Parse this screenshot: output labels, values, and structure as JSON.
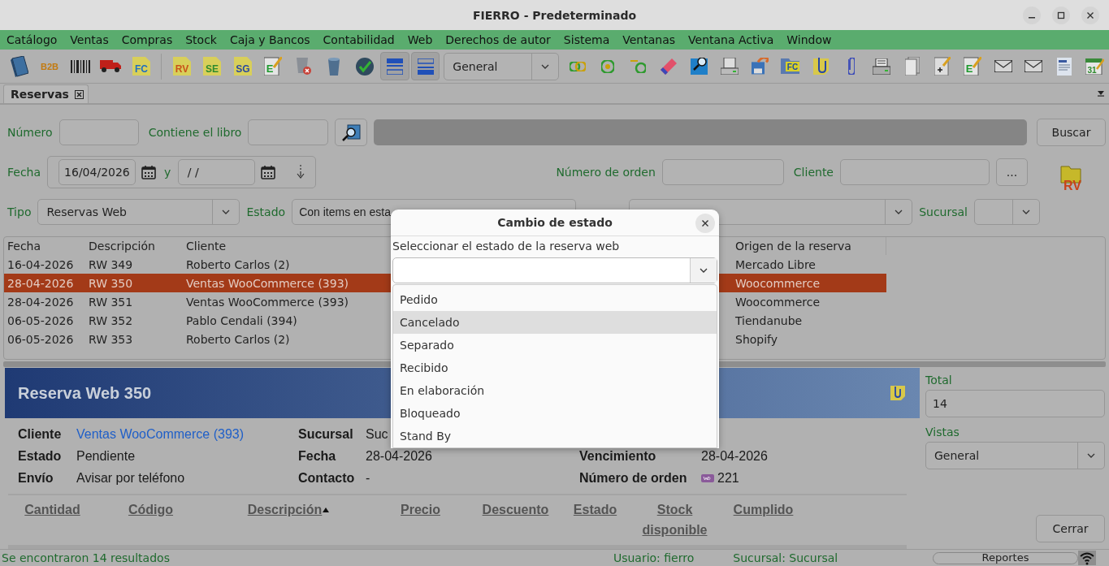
{
  "window": {
    "title": "FIERRO - Predeterminado"
  },
  "menu": [
    "Catálogo",
    "Ventas",
    "Compras",
    "Stock",
    "Caja y Bancos",
    "Contabilidad",
    "Web",
    "Derechos de autor",
    "Sistema",
    "Ventanas",
    "Ventana Activa",
    "Window"
  ],
  "toolbar": [
    {
      "kind": "book",
      "pressed": false
    },
    {
      "kind": "lettermark",
      "label": "B2B",
      "pressed": false
    },
    {
      "kind": "barcode",
      "pressed": false
    },
    {
      "kind": "truck",
      "pressed": false
    },
    {
      "kind": "doc",
      "label": "FC",
      "color": "#1f6fc0",
      "pressed": false
    },
    {
      "kind": "separator"
    },
    {
      "kind": "doc",
      "label": "RV",
      "color": "#c8521a",
      "pressed": false
    },
    {
      "kind": "doc",
      "label": "SE",
      "color": "#2e8b2e",
      "pressed": false
    },
    {
      "kind": "doc",
      "label": "SG",
      "color": "#2a4aa0",
      "pressed": false
    },
    {
      "kind": "edit",
      "label": "E",
      "color": "#1e9a2e",
      "pressed": false
    },
    {
      "kind": "bin-x",
      "pressed": false
    },
    {
      "kind": "bin",
      "pressed": false
    },
    {
      "kind": "refresh",
      "pressed": false
    },
    {
      "kind": "layout-top",
      "pressed": true
    },
    {
      "kind": "layout-bottom",
      "pressed": true
    },
    {
      "kind": "combo",
      "value": "General"
    },
    {
      "kind": "rings",
      "pressed": false
    },
    {
      "kind": "ring",
      "pressed": false
    },
    {
      "kind": "ring-line",
      "pressed": false
    },
    {
      "kind": "eraser",
      "pressed": false
    },
    {
      "kind": "search-doc",
      "pressed": false
    },
    {
      "kind": "printer-doc",
      "pressed": false
    },
    {
      "kind": "save",
      "pressed": false
    },
    {
      "kind": "folder-doc",
      "label": "FC",
      "color": "#1f4fa0",
      "pressed": false
    },
    {
      "kind": "note-clip",
      "pressed": false
    },
    {
      "kind": "clip",
      "pressed": false
    },
    {
      "kind": "printer",
      "pressed": false
    },
    {
      "kind": "pages",
      "pressed": false
    },
    {
      "kind": "doc-plus",
      "pressed": false
    },
    {
      "kind": "edit",
      "label": "E",
      "color": "#1e9a2e",
      "pressed": false
    },
    {
      "kind": "mail",
      "pressed": false
    },
    {
      "kind": "mail",
      "pressed": false
    },
    {
      "kind": "form",
      "pressed": false
    },
    {
      "kind": "calendar",
      "label": "31",
      "color": "#2e8b2e",
      "pressed": false
    }
  ],
  "tabs": [
    {
      "label": "Reservas",
      "selected": true
    }
  ],
  "filters": {
    "numero": {
      "label": "Número"
    },
    "libro": {
      "label": "Contiene el libro"
    },
    "search_button": "Buscar",
    "fecha": {
      "label": "Fecha",
      "from": "16/04/2026",
      "joiner": "y",
      "to": " / /"
    },
    "orden": {
      "label": "Número de orden"
    },
    "cliente": {
      "label": "Cliente",
      "button": "..."
    },
    "rv_icon": {
      "label": "RV"
    },
    "tipo": {
      "label": "Tipo",
      "value": "Reservas Web"
    },
    "estado": {
      "label": "Estado",
      "value": "Con items en esta"
    },
    "sucursal": {
      "label": "Sucursal"
    }
  },
  "table": {
    "columns": [
      "Fecha",
      "Descripción",
      "Cliente",
      "",
      "Origen de la reserva"
    ],
    "rows": [
      {
        "cells": [
          "16-04-2026",
          "RW 349",
          "Roberto Carlos (2)",
          "",
          "Mercado Libre"
        ],
        "selected": false
      },
      {
        "cells": [
          "28-04-2026",
          "RW 350",
          "Ventas WooCommerce (393)",
          "",
          "Woocommerce"
        ],
        "selected": true
      },
      {
        "cells": [
          "28-04-2026",
          "RW 351",
          "Ventas WooCommerce (393)",
          "",
          "Woocommerce"
        ],
        "selected": false
      },
      {
        "cells": [
          "06-05-2026",
          "RW 352",
          "Pablo Cendali (394)",
          "",
          "Tiendanube"
        ],
        "selected": false
      },
      {
        "cells": [
          "06-05-2026",
          "RW 353",
          "Roberto Carlos (2)",
          "",
          "Shopify"
        ],
        "selected": false
      }
    ]
  },
  "detail": {
    "title": "Reserva Web 350",
    "fields": [
      {
        "label": "Cliente",
        "value": "Ventas WooCommerce (393)",
        "kind": "link"
      },
      {
        "label": "Sucursal",
        "value": "Suc",
        "kind": "text"
      },
      {
        "kind": "empty"
      },
      {
        "label": "Estado",
        "value": "Pendiente",
        "kind": "text"
      },
      {
        "label": "Fecha",
        "value": "28-04-2026",
        "kind": "text"
      },
      {
        "label": "Vencimiento",
        "value": "28-04-2026",
        "kind": "text"
      },
      {
        "label": "Envío",
        "value": "Avisar por teléfono",
        "kind": "text"
      },
      {
        "label": "Contacto",
        "value": "-",
        "kind": "text"
      },
      {
        "label": "Número de orden",
        "value": "221",
        "kind": "woo"
      }
    ],
    "columns": [
      {
        "label": "Cantidad",
        "sorted": false
      },
      {
        "label": "Código",
        "sorted": false
      },
      {
        "label": "Descripción",
        "sorted": true
      },
      {
        "label": "Precio",
        "sorted": false
      },
      {
        "label": "Descuento",
        "sorted": false
      },
      {
        "label": "Estado",
        "sorted": false
      },
      {
        "label": "Stock disponible",
        "sorted": false
      },
      {
        "label": "Cumplido",
        "sorted": false
      }
    ]
  },
  "side": {
    "total_label": "Total",
    "total": "14",
    "vistas_label": "Vistas",
    "vistas": "General",
    "close_button": "Cerrar"
  },
  "status_bar": {
    "message": "Se encontraron 14 resultados",
    "user": "Usuario: fierro",
    "branch": "Sucursal: Sucursal",
    "reports": "Reportes"
  },
  "dialog": {
    "title": "Cambio de estado",
    "prompt": "Seleccionar el estado de la reserva web",
    "options": [
      {
        "label": "Pedido",
        "selected": false
      },
      {
        "label": "Cancelado",
        "selected": true
      },
      {
        "label": "Separado",
        "selected": false
      },
      {
        "label": "Recibido",
        "selected": false
      },
      {
        "label": "En elaboración",
        "selected": false
      },
      {
        "label": "Bloqueado",
        "selected": false
      },
      {
        "label": "Stand By",
        "selected": false
      }
    ]
  }
}
